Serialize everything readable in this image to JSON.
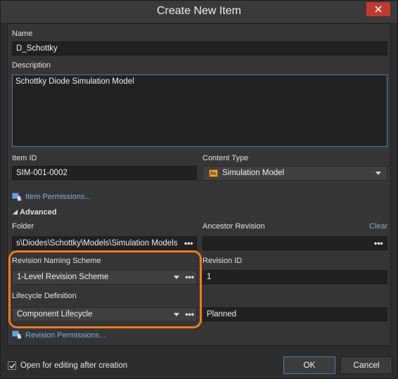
{
  "window": {
    "title": "Create New Item"
  },
  "name": {
    "label": "Name",
    "value": "D_Schottky"
  },
  "description": {
    "label": "Description",
    "value": "Schottky Diode Simulation Model"
  },
  "item_id": {
    "label": "Item ID",
    "value": "SIM-001-0002"
  },
  "content_type": {
    "label": "Content Type",
    "value": "Simulation Model",
    "icon": "simulation-model-icon"
  },
  "item_permissions": {
    "label": "Item Permissions..."
  },
  "advanced": {
    "label": "Advanced"
  },
  "folder": {
    "label": "Folder",
    "value": "s\\Diodes\\Schottky\\Models\\Simulation Models",
    "more": "•••"
  },
  "ancestor_revision": {
    "label": "Ancestor Revision",
    "clear": "Clear",
    "more": "•••"
  },
  "revision_naming_scheme": {
    "label": "Revision Naming Scheme",
    "value": "1-Level Revision Scheme",
    "more": "•••"
  },
  "revision_id": {
    "label": "Revision ID",
    "value": "1"
  },
  "lifecycle_definition": {
    "label": "Lifecycle Definition",
    "value": "Component Lifecycle",
    "more": "•••",
    "state": "Planned"
  },
  "revision_permissions": {
    "label": "Revision Permissions..."
  },
  "footer": {
    "open_for_editing": {
      "label": "Open for editing after creation",
      "checked": true
    },
    "ok_label": "OK",
    "cancel_label": "Cancel"
  },
  "colors": {
    "accent": "#f07b1b",
    "link": "#7fb0e0",
    "close": "#c2392b"
  }
}
